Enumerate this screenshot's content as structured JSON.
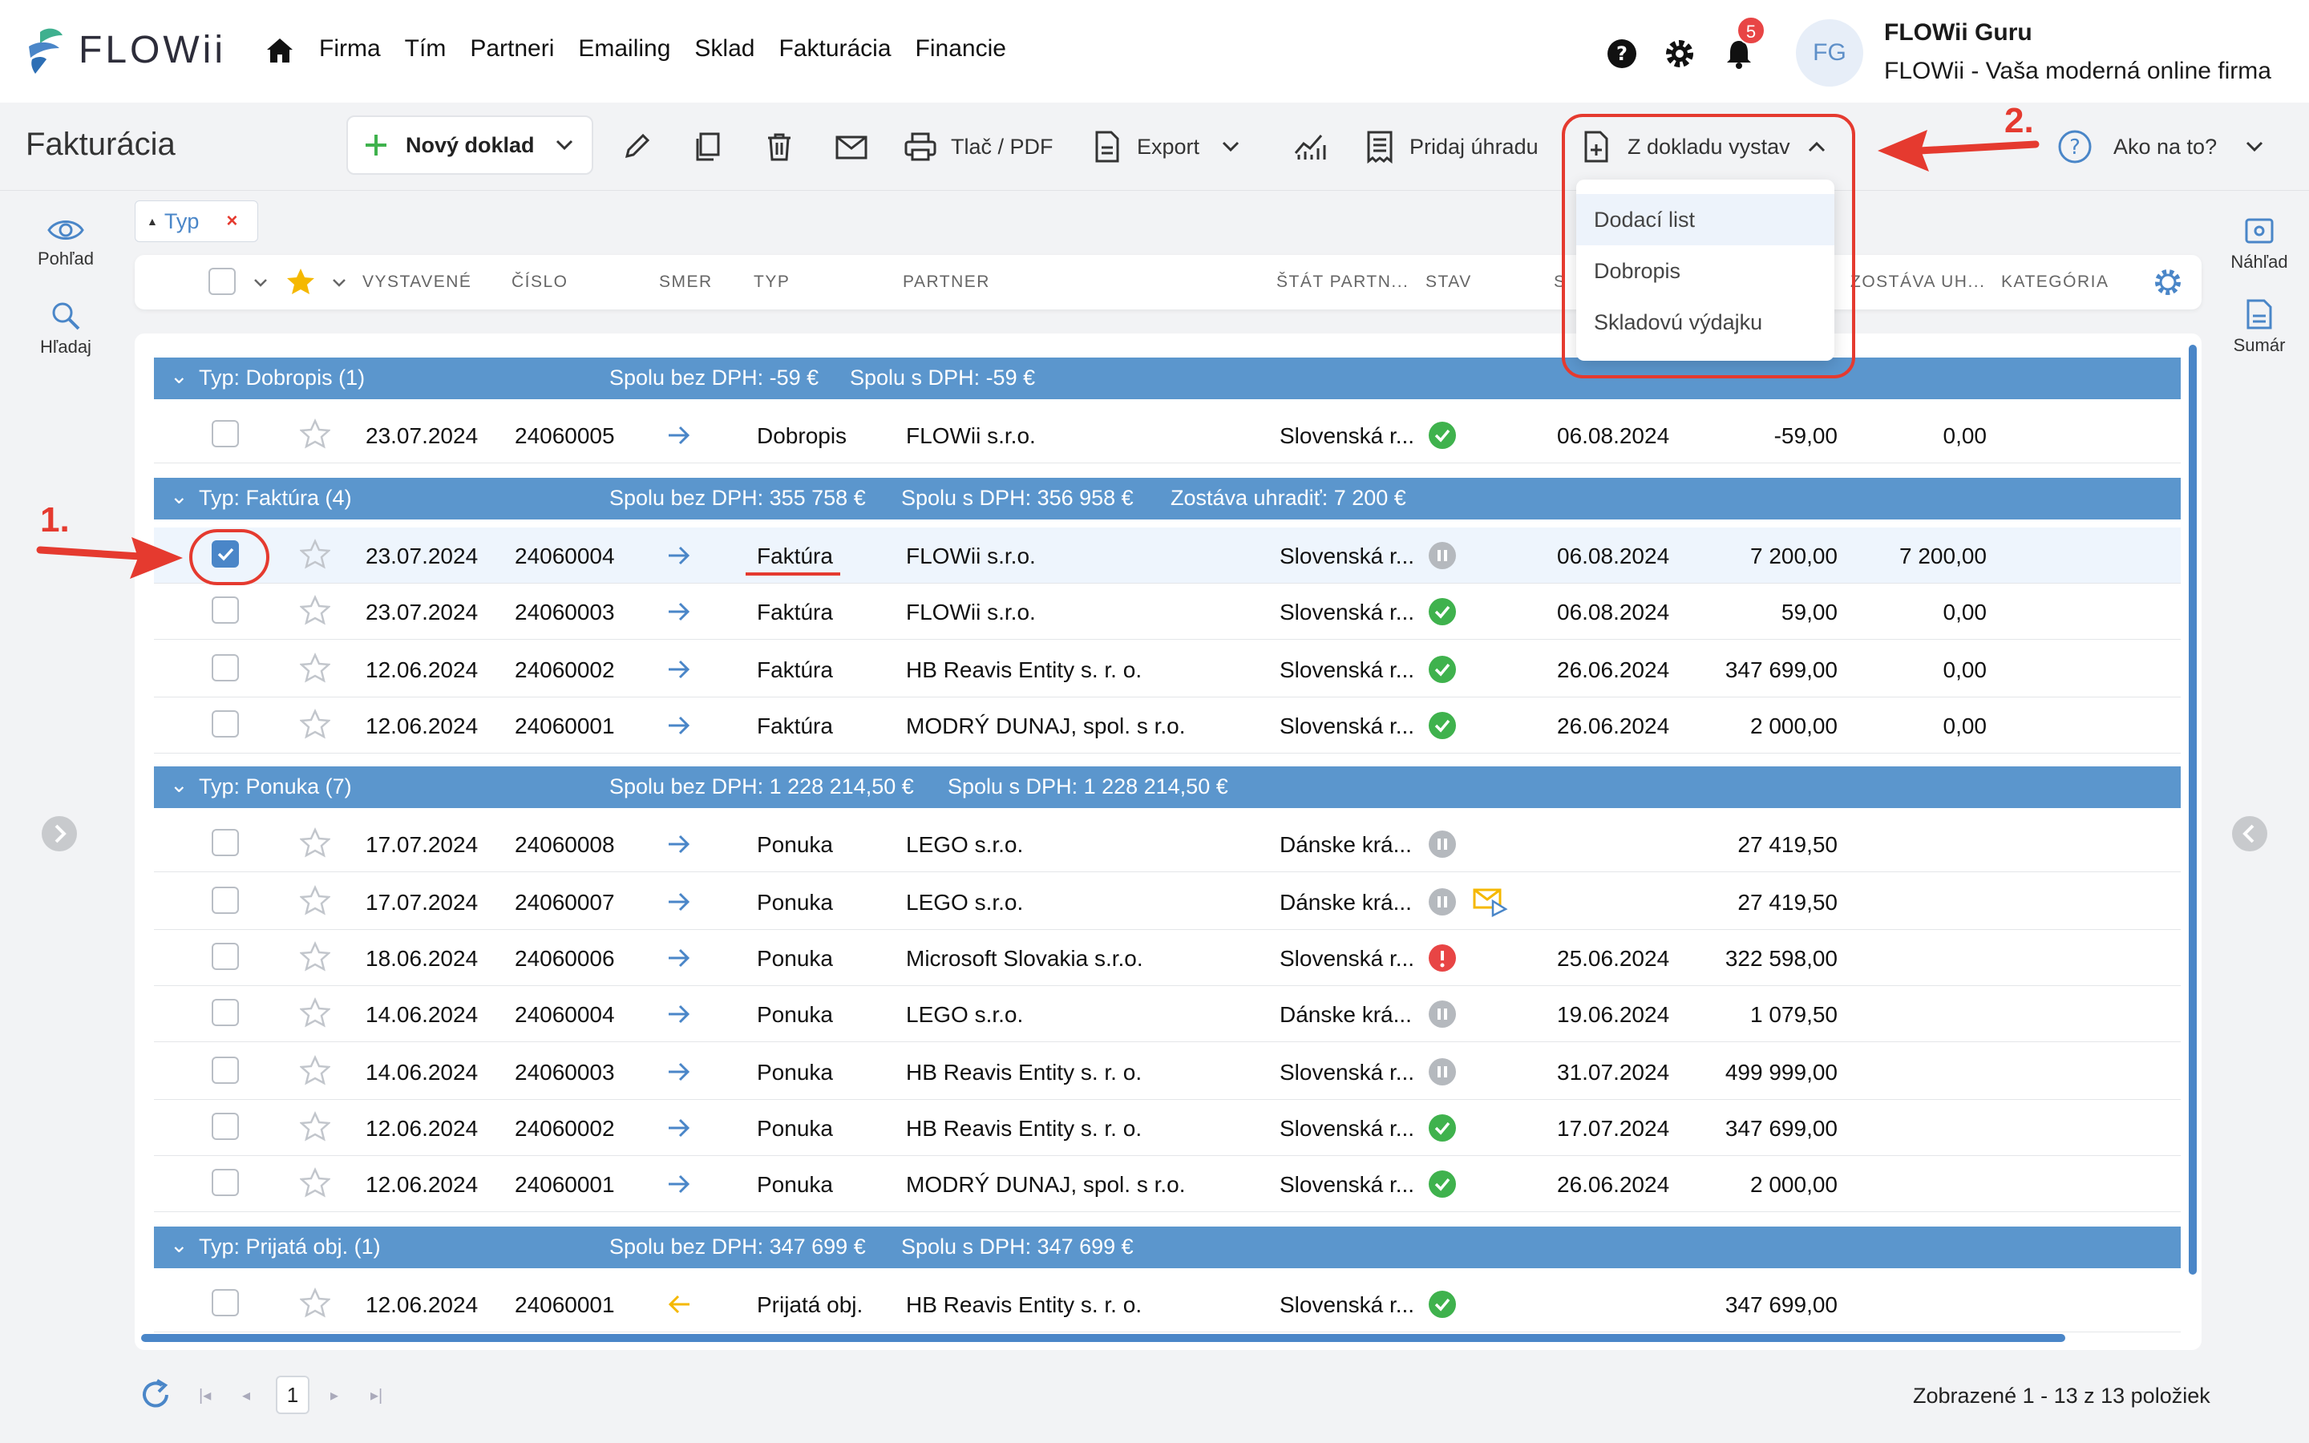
{
  "app": {
    "logo_text": "FLOWii",
    "nav": [
      "Firma",
      "Tím",
      "Partneri",
      "Emailing",
      "Sklad",
      "Fakturácia",
      "Financie"
    ],
    "notifications_count": "5",
    "avatar_initials": "FG",
    "user_name": "FLOWii Guru",
    "user_company": "FLOWii - Vaša moderná online firma"
  },
  "toolbar": {
    "page_title": "Fakturácia",
    "new_doc": "Nový doklad",
    "print_pdf": "Tlač / PDF",
    "export": "Export",
    "add_payment": "Pridaj úhradu",
    "from_doc": "Z dokladu vystav",
    "help": "Ako na to?"
  },
  "dropdown": {
    "items": [
      "Dodací list",
      "Dobropis",
      "Skladovú výdajku"
    ]
  },
  "annotations": {
    "one": "1.",
    "two": "2."
  },
  "rail": {
    "view": "Pohľad",
    "search": "Hľadaj",
    "preview": "Náhľad",
    "summary": "Sumár"
  },
  "filter_chip": {
    "label": "Typ",
    "remove": "×"
  },
  "columns": {
    "issued": "VYSTAVENÉ",
    "number": "ČÍSLO",
    "direction": "SMER",
    "type": "TYP",
    "partner": "PARTNER",
    "partner_country": "ŠTÁT PARTN...",
    "status": "STAV",
    "due": "S",
    "remaining": "ZOSTÁVA UH...",
    "category": "KATEGÓRIA"
  },
  "groups": [
    {
      "title": "Typ: Dobropis (1)",
      "sum_net": "Spolu bez DPH: -59 €",
      "sum_gross": "Spolu s DPH: -59 €",
      "remaining": ""
    },
    {
      "title": "Typ: Faktúra (4)",
      "sum_net": "Spolu bez DPH: 355 758 €",
      "sum_gross": "Spolu s DPH: 356 958 €",
      "remaining": "Zostáva uhradiť: 7 200 €"
    },
    {
      "title": "Typ: Ponuka (7)",
      "sum_net": "Spolu bez DPH: 1 228 214,50 €",
      "sum_gross": "Spolu s DPH: 1 228 214,50 €",
      "remaining": ""
    },
    {
      "title": "Typ: Prijatá obj. (1)",
      "sum_net": "Spolu bez DPH: 347 699 €",
      "sum_gross": "Spolu s DPH: 347 699 €",
      "remaining": ""
    }
  ],
  "rows": [
    {
      "date": "23.07.2024",
      "num": "24060005",
      "type": "Dobropis",
      "partner": "FLOWii s.r.o.",
      "country": "Slovenská r...",
      "due": "06.08.2024",
      "total": "-59,00",
      "remain": "0,00"
    },
    {
      "date": "23.07.2024",
      "num": "24060004",
      "type": "Faktúra",
      "partner": "FLOWii s.r.o.",
      "country": "Slovenská r...",
      "due": "06.08.2024",
      "total": "7 200,00",
      "remain": "7 200,00"
    },
    {
      "date": "23.07.2024",
      "num": "24060003",
      "type": "Faktúra",
      "partner": "FLOWii s.r.o.",
      "country": "Slovenská r...",
      "due": "06.08.2024",
      "total": "59,00",
      "remain": "0,00"
    },
    {
      "date": "12.06.2024",
      "num": "24060002",
      "type": "Faktúra",
      "partner": "HB Reavis Entity s. r. o.",
      "country": "Slovenská r...",
      "due": "26.06.2024",
      "total": "347 699,00",
      "remain": "0,00"
    },
    {
      "date": "12.06.2024",
      "num": "24060001",
      "type": "Faktúra",
      "partner": "MODRÝ DUNAJ, spol. s r.o.",
      "country": "Slovenská r...",
      "due": "26.06.2024",
      "total": "2 000,00",
      "remain": "0,00"
    },
    {
      "date": "17.07.2024",
      "num": "24060008",
      "type": "Ponuka",
      "partner": "LEGO s.r.o.",
      "country": "Dánske krá...",
      "due": "",
      "total": "27 419,50",
      "remain": ""
    },
    {
      "date": "17.07.2024",
      "num": "24060007",
      "type": "Ponuka",
      "partner": "LEGO s.r.o.",
      "country": "Dánske krá...",
      "due": "",
      "total": "27 419,50",
      "remain": ""
    },
    {
      "date": "18.06.2024",
      "num": "24060006",
      "type": "Ponuka",
      "partner": "Microsoft Slovakia s.r.o.",
      "country": "Slovenská r...",
      "due": "25.06.2024",
      "total": "322 598,00",
      "remain": ""
    },
    {
      "date": "14.06.2024",
      "num": "24060004",
      "type": "Ponuka",
      "partner": "LEGO s.r.o.",
      "country": "Dánske krá...",
      "due": "19.06.2024",
      "total": "1 079,50",
      "remain": ""
    },
    {
      "date": "14.06.2024",
      "num": "24060003",
      "type": "Ponuka",
      "partner": "HB Reavis Entity s. r. o.",
      "country": "Slovenská r...",
      "due": "31.07.2024",
      "total": "499 999,00",
      "remain": ""
    },
    {
      "date": "12.06.2024",
      "num": "24060002",
      "type": "Ponuka",
      "partner": "HB Reavis Entity s. r. o.",
      "country": "Slovenská r...",
      "due": "17.07.2024",
      "total": "347 699,00",
      "remain": ""
    },
    {
      "date": "12.06.2024",
      "num": "24060001",
      "type": "Ponuka",
      "partner": "MODRÝ DUNAJ, spol. s r.o.",
      "country": "Slovenská r...",
      "due": "26.06.2024",
      "total": "2 000,00",
      "remain": ""
    },
    {
      "date": "12.06.2024",
      "num": "24060001",
      "type": "Prijatá obj.",
      "partner": "HB Reavis Entity s. r. o.",
      "country": "Slovenská r...",
      "due": "",
      "total": "347 699,00",
      "remain": ""
    }
  ],
  "pagination": {
    "current": "1",
    "info": "Zobrazené 1 - 13 z 13 položiek"
  },
  "colors": {
    "accent": "#4a86c8",
    "group": "#5b96cd",
    "success": "#3fb24d",
    "danger": "#e84545",
    "annotation": "#e53a2f"
  }
}
